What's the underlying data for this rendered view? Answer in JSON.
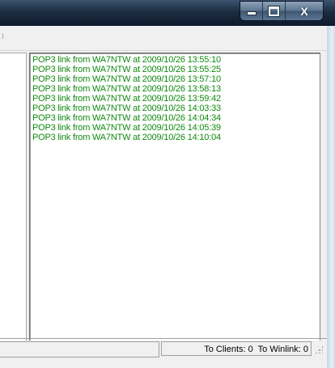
{
  "window": {
    "title": "",
    "caption_buttons": {
      "minimize_icon": "minimize-icon",
      "maximize_icon": "maximize-icon",
      "close_glyph": "X"
    }
  },
  "log": {
    "color": "#0f8a0f",
    "lines": [
      "POP3 link from WA7NTW at 2009/10/26 13:55:10",
      "POP3 link from WA7NTW at 2009/10/26 13:55:25",
      "POP3 link from WA7NTW at 2009/10/26 13:57:10",
      "POP3 link from WA7NTW at 2009/10/26 13:58:13",
      "POP3 link from WA7NTW at 2009/10/26 13:59:42",
      "POP3 link from WA7NTW at 2009/10/26 14:03:33",
      "POP3 link from WA7NTW at 2009/10/26 14:04:34",
      "POP3 link from WA7NTW at 2009/10/26 14:05:39",
      "POP3 link from WA7NTW at 2009/10/26 14:10:04"
    ]
  },
  "status": {
    "left_text": "",
    "right_text": "To Clients: 0  To Winlink: 0"
  }
}
